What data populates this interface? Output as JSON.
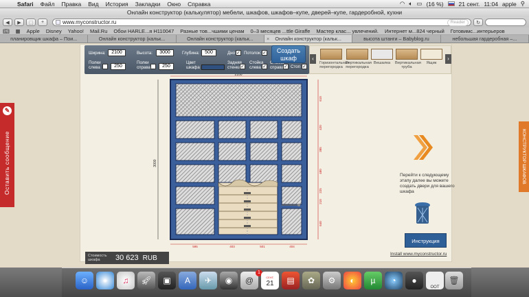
{
  "menubar": {
    "app_name": "Safari",
    "items": [
      "Файл",
      "Правка",
      "Вид",
      "История",
      "Закладки",
      "Окно",
      "Справка"
    ],
    "battery": "(16 %)",
    "date": "21 сент.",
    "time": "11:04",
    "user": "apple"
  },
  "window": {
    "title": "Онлайн конструктор (калькулятор) мебели, шкафов, шкафов–купе, дверей–купе, гардеробной, кухни"
  },
  "toolbar": {
    "url": "www.myconstructor.ru",
    "reader_label": "Reader"
  },
  "bookmarks": [
    "Apple",
    "Disney",
    "Yahoo!",
    "Mail.Ru",
    "Обои HARLE...я H110047",
    "Разные тов...чшими ценам",
    "0–3 месяцев ...ttle Giraffe",
    "Мастер клас... увлечений.",
    "Интернет м...824 черный",
    "Готовимс...интерьеров"
  ],
  "tabs": [
    {
      "label": "планировщик шкафа – Пои...",
      "active": false
    },
    {
      "label": "Онлайн конструктор (кальк...",
      "active": false
    },
    {
      "label": "Онлайн конструктор (кальк...",
      "active": false
    },
    {
      "label": "Онлайн конструктор (кальк...",
      "active": true
    },
    {
      "label": "высота штанги – Babyblog.ru",
      "active": false
    },
    {
      "label": "небольшая гардеробная –...",
      "active": false
    }
  ],
  "controls": {
    "width_label": "Ширина:",
    "width_value": "2100",
    "height_label": "Высота:",
    "height_value": "3000",
    "depth_label": "Глубина:",
    "depth_value": "500",
    "bottom_label": "Дно",
    "ceiling_label": "Потолок:",
    "shelves_left_label": "Полки слева",
    "shelves_left_value": "250",
    "shelves_right_label": "Полки справа",
    "shelves_right_value": "250",
    "color_label": "Цвет шкафа",
    "back_wall_label": "Задняя стенка",
    "post_left_label": "Стойка слева",
    "post_right_label": "Стойка справа",
    "stops_label": "Стоп",
    "create_label": "Создать шкаф",
    "color_hex": "#305080"
  },
  "tools": [
    {
      "label": "Горизонтальная перегородка"
    },
    {
      "label": "Вертикальная перегородка"
    },
    {
      "label": "Вешалка"
    },
    {
      "label": "Вертикальная труба"
    },
    {
      "label": "Ящик"
    }
  ],
  "dimensions": {
    "top": "2100",
    "left": "3000",
    "right": [
      "610",
      "420",
      "385",
      "480",
      "225",
      "210",
      "640"
    ],
    "bottom": [
      "595",
      "403",
      "501",
      "404"
    ]
  },
  "side_panel": {
    "next_text": "Перейти к следующему этапу далее вы можете создать двери для вашего шкафа",
    "instruction_label": "Инструкция",
    "site_link": "Install www.myconstructor.ru"
  },
  "price": {
    "label": "Стоимость шкафа",
    "value": "30 623",
    "currency": "RUB"
  },
  "left_tab": {
    "label": "Оставить сообщение"
  },
  "right_tab": {
    "label": "КОНСТРУКТОР ШКАФОВ"
  },
  "dock": {
    "calendar_day": "21",
    "calendar_month": "СЕНТ.",
    "badge_mail": "1",
    "trash_label": "OOT"
  }
}
